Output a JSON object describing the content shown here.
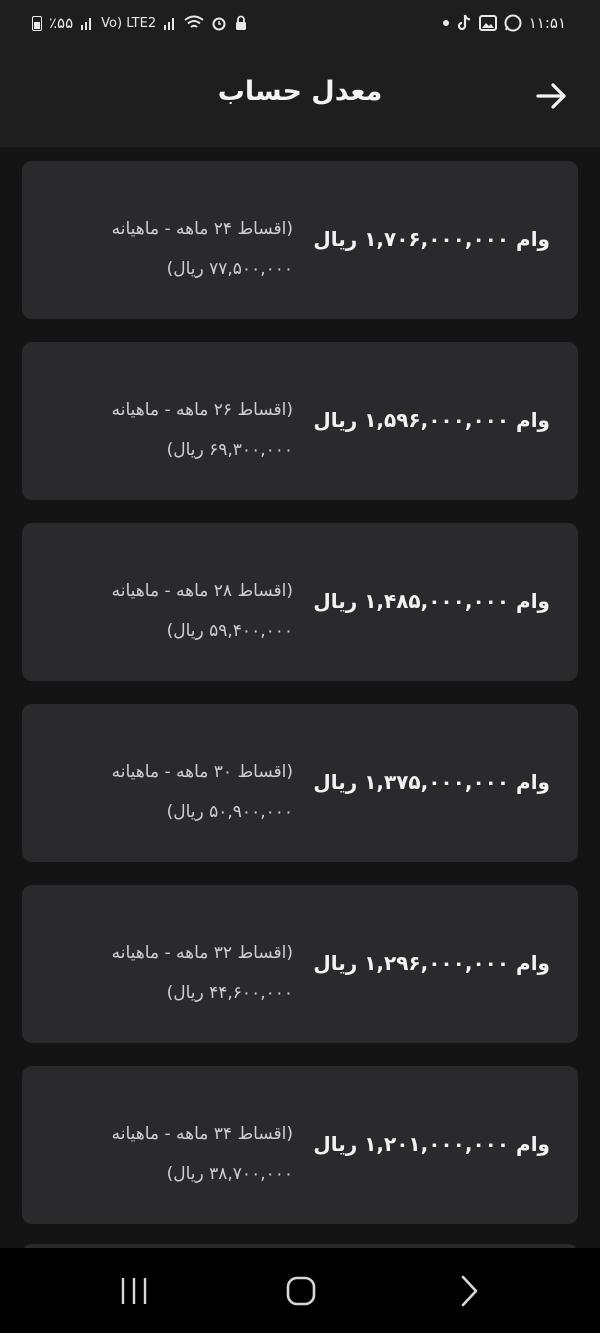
{
  "status_bar": {
    "time": "۱۱:۵۱",
    "battery": "٪۵۵",
    "network": "Vo) LTE2"
  },
  "header": {
    "title": "معدل حساب"
  },
  "loans": [
    {
      "amount": "وام ۱,۷۰۶,۰۰۰,۰۰۰ ریال",
      "terms": "(اقساط ۲۴ ماهه - ماهیانه",
      "monthly": "۷۷,۵۰۰,۰۰۰ ریال)"
    },
    {
      "amount": "وام ۱,۵۹۶,۰۰۰,۰۰۰ ریال",
      "terms": "(اقساط ۲۶ ماهه - ماهیانه",
      "monthly": "۶۹,۳۰۰,۰۰۰ ریال)"
    },
    {
      "amount": "وام ۱,۴۸۵,۰۰۰,۰۰۰ ریال",
      "terms": "(اقساط ۲۸ ماهه - ماهیانه",
      "monthly": "۵۹,۴۰۰,۰۰۰ ریال)"
    },
    {
      "amount": "وام ۱,۳۷۵,۰۰۰,۰۰۰ ریال",
      "terms": "(اقساط ۳۰ ماهه - ماهیانه",
      "monthly": "۵۰,۹۰۰,۰۰۰ ریال)"
    },
    {
      "amount": "وام ۱,۲۹۶,۰۰۰,۰۰۰ ریال",
      "terms": "(اقساط ۳۲ ماهه - ماهیانه",
      "monthly": "۴۴,۶۰۰,۰۰۰ ریال)"
    },
    {
      "amount": "وام ۱,۲۰۱,۰۰۰,۰۰۰ ریال",
      "terms": "(اقساط ۳۴ ماهه - ماهیانه",
      "monthly": "۳۸,۷۰۰,۰۰۰ ریال)"
    }
  ]
}
